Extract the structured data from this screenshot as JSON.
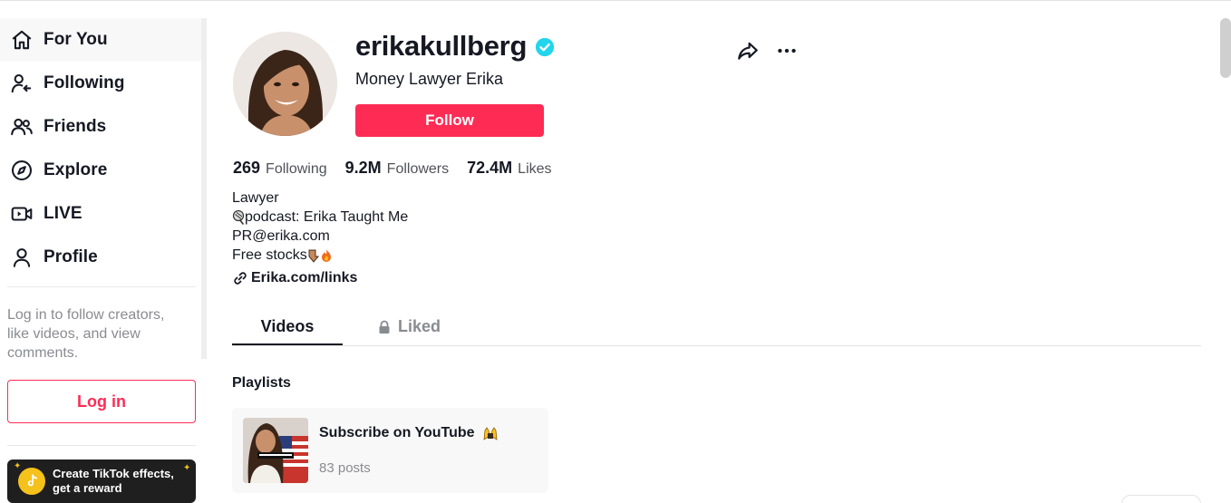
{
  "sidebar": {
    "items": [
      {
        "label": "For You",
        "icon": "home-icon"
      },
      {
        "label": "Following",
        "icon": "following-icon"
      },
      {
        "label": "Friends",
        "icon": "friends-icon"
      },
      {
        "label": "Explore",
        "icon": "compass-icon"
      },
      {
        "label": "LIVE",
        "icon": "live-icon"
      },
      {
        "label": "Profile",
        "icon": "profile-icon"
      }
    ],
    "active_index": 0,
    "login_prompt": "Log in to follow creators, like videos, and view comments.",
    "login_label": "Log in",
    "effects_banner_line1": "Create TikTok effects,",
    "effects_banner_line2": "get a reward"
  },
  "profile": {
    "username": "erikakullberg",
    "verified": true,
    "nickname": "Money Lawyer Erika",
    "follow_label": "Follow",
    "stats": {
      "following_count": "269",
      "following_label": "Following",
      "followers_count": "9.2M",
      "followers_label": "Followers",
      "likes_count": "72.4M",
      "likes_label": "Likes"
    },
    "bio": {
      "line1": "Lawyer",
      "line2": "podcast: Erika Taught Me",
      "line3": "PR@erika.com",
      "line4": "Free stocks"
    },
    "link": "Erika.com/links"
  },
  "tabs": {
    "videos_label": "Videos",
    "liked_label": "Liked"
  },
  "playlists": {
    "title": "Playlists",
    "items": [
      {
        "name": "Subscribe on YouTube",
        "count": "83 posts"
      }
    ]
  },
  "colors": {
    "accent": "#fe2c55",
    "verified": "#20d5ec",
    "text": "#161823",
    "muted": "#8a8b91"
  }
}
